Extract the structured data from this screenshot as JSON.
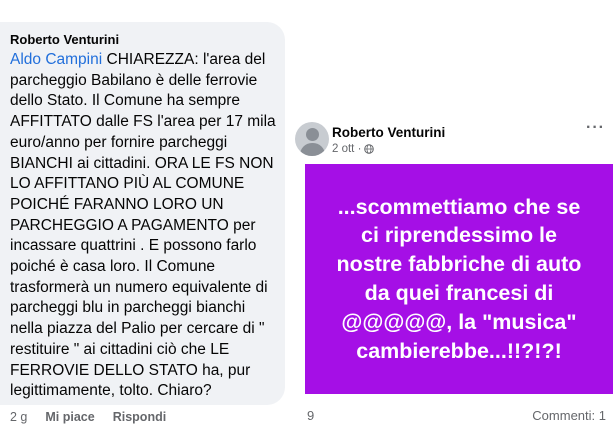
{
  "comment": {
    "author": "Roberto Venturini",
    "mention": "Aldo Campini",
    "text": " CHIAREZZA: l'area del\nparcheggio Babilano è delle ferrovie\ndello Stato. Il Comune ha sempre\nAFFITTATO dalle FS l'area per 17 mila\neuro/anno per fornire parcheggi\nBIANCHI ai cittadini. ORA LE FS NON\nLO AFFITTANO PIÙ AL COMUNE\nPOICHÉ FARANNO LORO UN\nPARCHEGGIO A PAGAMENTO per\nincassare quattrini . E possono farlo\npoiché è  casa loro. Il Comune\ntrasformerà un numero equivalente di\nparcheggi blu in parcheggi bianchi\nnella piazza del Palio per cercare di \"\nrestituire \" ai cittadini ciò che LE\nFERROVIE DELLO STATO  ha, pur\nlegittimamente, tolto. Chiaro?",
    "time": "2 g",
    "like_label": "Mi piace",
    "reply_label": "Rispondi"
  },
  "post": {
    "author": "Roberto Venturini",
    "time": "2 ott ·",
    "more": "···",
    "banner_text": "...scommettiamo che se\nci riprendessimo  le\nnostre fabbriche di auto\nda quei francesi di\n@@@@@, la \"musica\"\ncambierebbe...!!?!?!",
    "banner_color": "#a50fe6",
    "reactions_count": "9",
    "comments_label": "Commenti: 1"
  }
}
